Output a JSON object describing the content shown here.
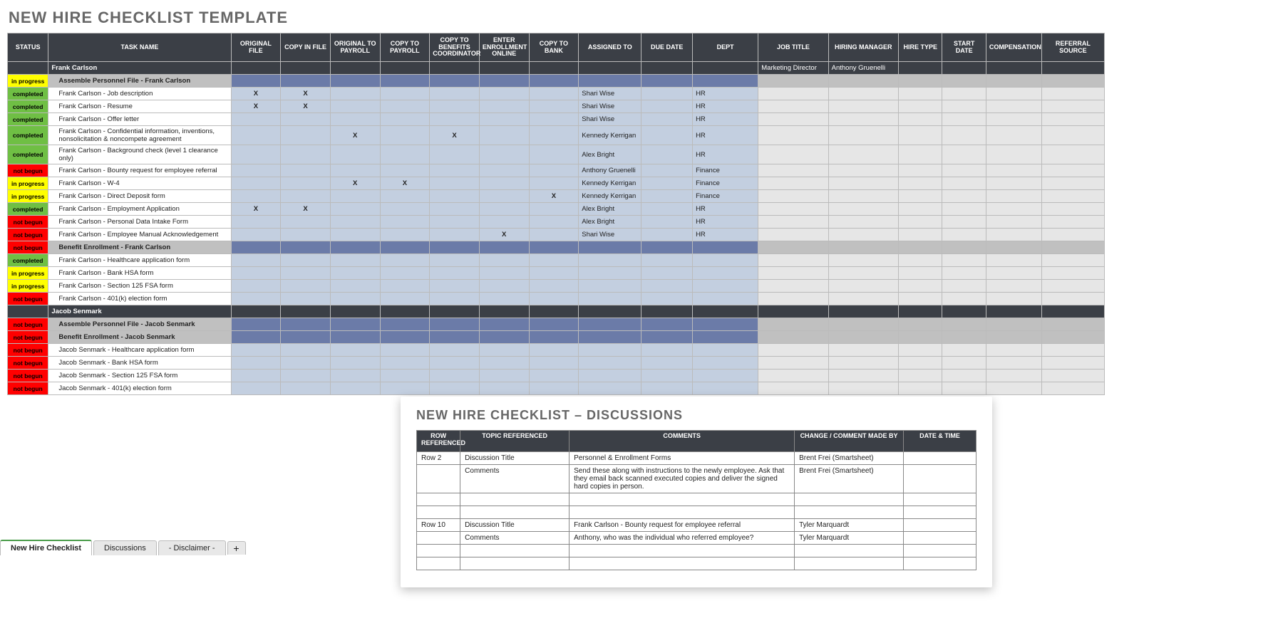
{
  "title": "NEW HIRE CHECKLIST TEMPLATE",
  "columns": [
    "STATUS",
    "TASK NAME",
    "ORIGINAL FILE",
    "COPY IN FILE",
    "ORIGINAL TO PAYROLL",
    "COPY TO PAYROLL",
    "COPY TO BENEFITS COORDINATOR",
    "ENTER ENROLLMENT ONLINE",
    "COPY TO BANK",
    "ASSIGNED TO",
    "DUE DATE",
    "DEPT",
    "JOB TITLE",
    "HIRING MANAGER",
    "HIRE TYPE",
    "START DATE",
    "COMPENSATION",
    "REFERRAL SOURCE"
  ],
  "status_labels": {
    "in_progress": "in progress",
    "completed": "completed",
    "not_begun": "not begun"
  },
  "rows": [
    {
      "type": "person",
      "task": "Frank Carlson",
      "job_title": "Marketing Director",
      "hiring_manager": "Anthony Gruenelli"
    },
    {
      "type": "section",
      "status": "in_progress",
      "task": "Assemble Personnel File - Frank Carlson"
    },
    {
      "type": "task",
      "status": "completed",
      "task": "Frank Carlson - Job description",
      "orig_file": "X",
      "copy_file": "X",
      "assigned": "Shari Wise",
      "dept": "HR"
    },
    {
      "type": "task",
      "status": "completed",
      "task": "Frank Carlson - Resume",
      "orig_file": "X",
      "copy_file": "X",
      "assigned": "Shari Wise",
      "dept": "HR"
    },
    {
      "type": "task",
      "status": "completed",
      "task": "Frank Carlson - Offer letter",
      "assigned": "Shari Wise",
      "dept": "HR"
    },
    {
      "type": "task",
      "status": "completed",
      "task": "Frank Carlson - Confidential information, inventions, nonsolicitation & noncompete agreement",
      "orig_payroll": "X",
      "benefits": "X",
      "assigned": "Kennedy Kerrigan",
      "dept": "HR"
    },
    {
      "type": "task",
      "status": "completed",
      "task": "Frank Carlson - Background check (level 1 clearance only)",
      "assigned": "Alex Bright",
      "dept": "HR"
    },
    {
      "type": "task",
      "status": "not_begun",
      "task": "Frank Carlson - Bounty request for employee referral",
      "assigned": "Anthony Gruenelli",
      "dept": "Finance"
    },
    {
      "type": "task",
      "status": "in_progress",
      "task": "Frank Carlson - W-4",
      "orig_payroll": "X",
      "copy_payroll": "X",
      "assigned": "Kennedy Kerrigan",
      "dept": "Finance"
    },
    {
      "type": "task",
      "status": "in_progress",
      "task": "Frank Carlson - Direct Deposit form",
      "bank": "X",
      "assigned": "Kennedy Kerrigan",
      "dept": "Finance"
    },
    {
      "type": "task",
      "status": "completed",
      "task": "Frank Carlson - Employment Application",
      "orig_file": "X",
      "copy_file": "X",
      "assigned": "Alex Bright",
      "dept": "HR"
    },
    {
      "type": "task",
      "status": "not_begun",
      "task": "Frank Carlson - Personal Data Intake Form",
      "assigned": "Alex Bright",
      "dept": "HR"
    },
    {
      "type": "task",
      "status": "not_begun",
      "task": "Frank Carlson - Employee Manual Acknowledgement",
      "enroll": "X",
      "assigned": "Shari Wise",
      "dept": "HR"
    },
    {
      "type": "section",
      "status": "not_begun",
      "task": "Benefit Enrollment - Frank Carlson"
    },
    {
      "type": "task",
      "status": "completed",
      "task": "Frank Carlson - Healthcare application form"
    },
    {
      "type": "task",
      "status": "in_progress",
      "task": "Frank Carlson - Bank HSA form"
    },
    {
      "type": "task",
      "status": "in_progress",
      "task": "Frank Carlson - Section 125 FSA form"
    },
    {
      "type": "task",
      "status": "not_begun",
      "task": "Frank Carlson - 401(k) election form"
    },
    {
      "type": "person",
      "task": "Jacob Senmark"
    },
    {
      "type": "section",
      "status": "not_begun",
      "task": "Assemble Personnel File - Jacob Senmark"
    },
    {
      "type": "section",
      "status": "not_begun",
      "task": "Benefit Enrollment - Jacob Senmark"
    },
    {
      "type": "task",
      "status": "not_begun",
      "task": "Jacob Senmark - Healthcare application form"
    },
    {
      "type": "task",
      "status": "not_begun",
      "task": "Jacob Senmark - Bank HSA form"
    },
    {
      "type": "task",
      "status": "not_begun",
      "task": "Jacob Senmark - Section 125 FSA form"
    },
    {
      "type": "task",
      "status": "not_begun",
      "task": "Jacob Senmark - 401(k) election form"
    }
  ],
  "discussions": {
    "title": "NEW HIRE CHECKLIST  –  DISCUSSIONS",
    "columns": [
      "ROW REFERENCED",
      "TOPIC REFERENCED",
      "COMMENTS",
      "CHANGE / COMMENT MADE BY",
      "DATE & TIME"
    ],
    "rows": [
      {
        "row": "Row 2",
        "topic": "Discussion Title",
        "comments": "Personnel & Enrollment Forms",
        "who": "Brent Frei (Smartsheet)",
        "dt": ""
      },
      {
        "row": "",
        "topic": "Comments",
        "comments": "Send these along with instructions to the newly employee.  Ask that they email back scanned executed copies and deliver the signed hard copies in person.",
        "who": "Brent Frei (Smartsheet)",
        "dt": ""
      },
      {
        "row": "",
        "topic": "",
        "comments": "",
        "who": "",
        "dt": ""
      },
      {
        "row": "",
        "topic": "",
        "comments": "",
        "who": "",
        "dt": ""
      },
      {
        "row": "Row 10",
        "topic": "Discussion Title",
        "comments": "Frank Carlson - Bounty request for employee referral",
        "who": "Tyler Marquardt",
        "dt": ""
      },
      {
        "row": "",
        "topic": "Comments",
        "comments": "Anthony, who was the individual who referred employee?",
        "who": "Tyler Marquardt",
        "dt": ""
      },
      {
        "row": "",
        "topic": "",
        "comments": "",
        "who": "",
        "dt": ""
      },
      {
        "row": "",
        "topic": "",
        "comments": "",
        "who": "",
        "dt": ""
      }
    ]
  },
  "tabs": {
    "items": [
      "New Hire Checklist",
      "Discussions",
      "- Disclaimer -"
    ],
    "add": "+"
  }
}
